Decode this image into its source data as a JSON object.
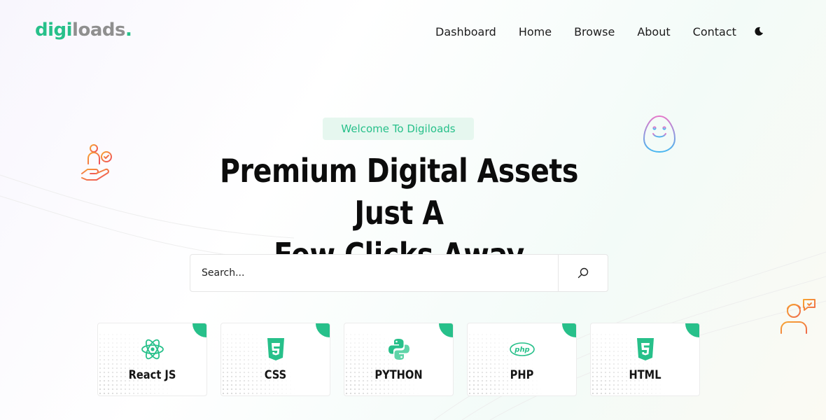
{
  "header": {
    "logo": {
      "main": "digi",
      "tail": "loads",
      "dot": "."
    },
    "nav": [
      "Dashboard",
      "Home",
      "Browse",
      "About",
      "Contact"
    ],
    "theme_toggle_icon": "moon-icon"
  },
  "hero": {
    "badge": "Welcome To Digiloads",
    "title_line1": "Premium Digital Assets Just A",
    "title_line2": "Few Clicks Away"
  },
  "search": {
    "placeholder": "Search...",
    "button_icon": "search-icon"
  },
  "categories": [
    {
      "label": "React JS",
      "icon": "react-icon"
    },
    {
      "label": "CSS",
      "icon": "css3-icon"
    },
    {
      "label": "PYTHON",
      "icon": "python-icon"
    },
    {
      "label": "PHP",
      "icon": "php-icon"
    },
    {
      "label": "HTML",
      "icon": "html5-icon"
    }
  ],
  "colors": {
    "accent": "#27c08a",
    "badge_bg": "#e6f7ef",
    "logo_tail": "#8f8f8f",
    "text": "#111111"
  }
}
